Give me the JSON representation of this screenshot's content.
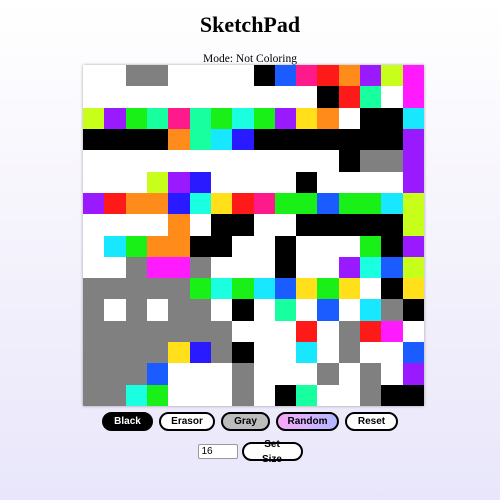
{
  "header": {
    "title": "SketchPad",
    "mode_text": "Mode: Not Coloring"
  },
  "grid": {
    "size": 16,
    "palette": {
      "W": "#ffffff",
      "K": "#000000",
      "G": "#808080",
      "r": "#ff1a1a",
      "o": "#ff8c1a",
      "y": "#ffe01a",
      "l": "#c8ff1a",
      "g": "#18f018",
      "s": "#18ffa0",
      "c": "#18e8ff",
      "b": "#1a5cff",
      "u": "#2a1aff",
      "v": "#9a1aff",
      "m": "#ff1aff",
      "p": "#ff1a8c",
      "k": "#ff1aa8",
      "t": "#1affe0"
    },
    "rows": [
      "WWGGWWWWKbprovlm",
      "WWWWWWWWWWWKrsWm",
      "lvgspsgtgvyoWKKc",
      "KKKKoscuKKKKKKKv",
      "WWWWWWWWWWWWKGGv",
      "WWWlvuWWWWKWWWWv",
      "vrooutyrpggbggcl",
      "WWWWoWKKWWKKKKKl",
      "WcgooKKWWKWWWgKv",
      "WWGmmGWWWKWWvtbl",
      "GGGGGgtgcbygyWKy",
      "GWGWGGWKWsWbWcGK",
      "GGGGGGGWWWrWGrmW",
      "GGGGyuGKWWcWGWWb",
      "GGGbWWWGWWWGWGWv",
      "GGtgWWWGWKsWWGKK"
    ]
  },
  "controls": {
    "black": "Black",
    "eraser": "Erasor",
    "gray": "Gray",
    "random": "Random",
    "reset": "Reset",
    "size_value": "16",
    "set_size": "Set Size"
  }
}
